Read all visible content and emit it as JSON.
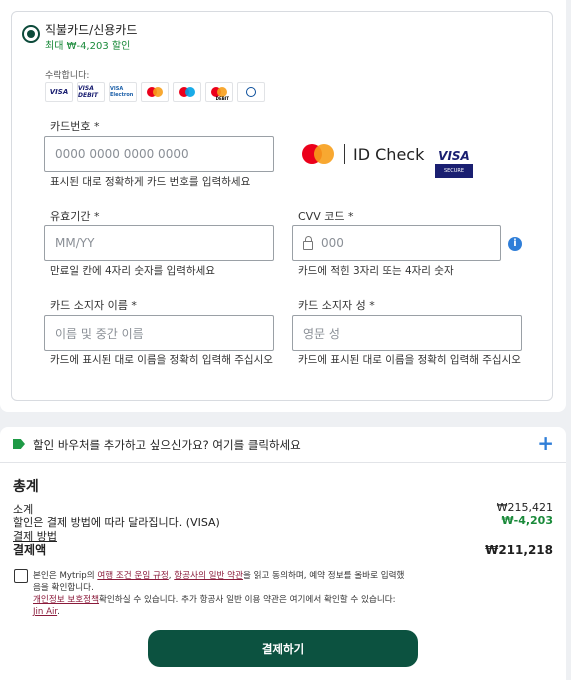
{
  "payment_option": {
    "title": "직불카드/신용카드",
    "subtitle": "최대 ₩-4,203 할인",
    "accepted_label": "수락합니다:",
    "logos": [
      {
        "text": "VISA",
        "icon": "visa-logo"
      },
      {
        "text": "VISA DEBIT",
        "icon": "visa-debit-logo"
      },
      {
        "text": "VISA Electron",
        "icon": "visa-electron-logo"
      },
      {
        "text": "",
        "icon": "mastercard-logo"
      },
      {
        "text": "",
        "icon": "maestro-logo"
      },
      {
        "text": "DEBIT",
        "icon": "mastercard-debit-logo"
      },
      {
        "text": "",
        "icon": "diners-club-logo"
      }
    ],
    "card_number": {
      "label": "카드번호 *",
      "placeholder": "0000 0000 0000 0000",
      "hint": "표시된 대로 정확하게 카드 번호를 입력하세요"
    },
    "id_check": {
      "text": "ID Check"
    },
    "visa_secure": {
      "visa": "VISA",
      "secure": "SECURE"
    },
    "expiry": {
      "label": "유효기간 *",
      "placeholder": "MM/YY",
      "hint": "만료일 칸에 4자리 숫자를 입력하세요"
    },
    "cvv": {
      "label": "CVV 코드 *",
      "placeholder": "000",
      "hint": "카드에 적힌 3자리 또는 4자리 숫자",
      "info": "i"
    },
    "first_name": {
      "label": "카드 소지자 이름 *",
      "placeholder": "이름 및 중간 이름",
      "hint": "카드에 표시된 대로 이름을 정확히 입력해 주십시오"
    },
    "last_name": {
      "label": "카드 소지자 성 *",
      "placeholder": "영문 성",
      "hint": "카드에 표시된 대로 이름을 정확히 입력해 주십시오"
    }
  },
  "voucher": {
    "text": "할인 바우처를 추가하고 싶으신가요? 여기를 클릭하세요",
    "plus": "+"
  },
  "summary": {
    "title": "총계",
    "subtotal_label": "소계",
    "subtotal_value": "₩215,421",
    "discount_label": "할인은 결제 방법에 따라 달라집니다. (VISA)",
    "discount_value": "₩-4,203",
    "payment_method_link": "결제 방법",
    "total_label": "결제액",
    "total_value": "₩211,218"
  },
  "terms": {
    "p1": "본인은 Mytrip의 ",
    "l1": "여행 조건 운임 규정",
    "p2": ", ",
    "l2": "항공사의 일반 약관",
    "p3": "을 읽고 동의하며, 예약 정보를 올바로 입력했음을 확인합니다.",
    "l3": "개인정보 보호정책",
    "p4": "확인하실 수 있습니다. 추가 항공사 일반 이용 약관은 여기에서 확인할 수 있습니다: ",
    "l4": "Jin Air",
    "p5": "."
  },
  "pay_button": "결제하기"
}
